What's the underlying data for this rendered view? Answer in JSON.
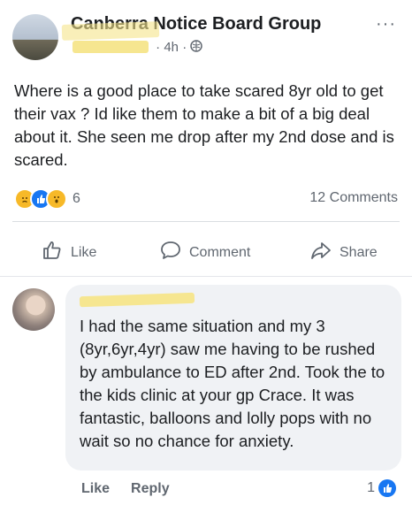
{
  "post": {
    "group_name": "Canberra Notice Board Group",
    "meta_time": "4h",
    "more_label": "···",
    "text": "Where is a good place to take scared 8yr old to get their vax ? Id like them to make a bit of a big deal about it. She seen me drop after my 2nd dose and is scared.",
    "reaction_count": "6",
    "comments_count": "12 Comments",
    "reactions": [
      "sad-react-icon",
      "like-react-icon",
      "wow-react-icon"
    ]
  },
  "actions": {
    "like": "Like",
    "comment": "Comment",
    "share": "Share"
  },
  "comment": {
    "text": "I had the same situation and my 3 (8yr,6yr,4yr) saw me having to be rushed by ambulance to ED after 2nd. Took the to the kids clinic at your gp Crace. It was fantastic, balloons and lolly pops with no wait so no chance for anxiety.",
    "like_label": "Like",
    "reply_label": "Reply",
    "like_count": "1"
  },
  "colors": {
    "meta_gray": "#606770",
    "like_blue": "#1877f2",
    "bubble_bg": "#f0f2f5",
    "redaction_yellow": "#f5e58a"
  }
}
